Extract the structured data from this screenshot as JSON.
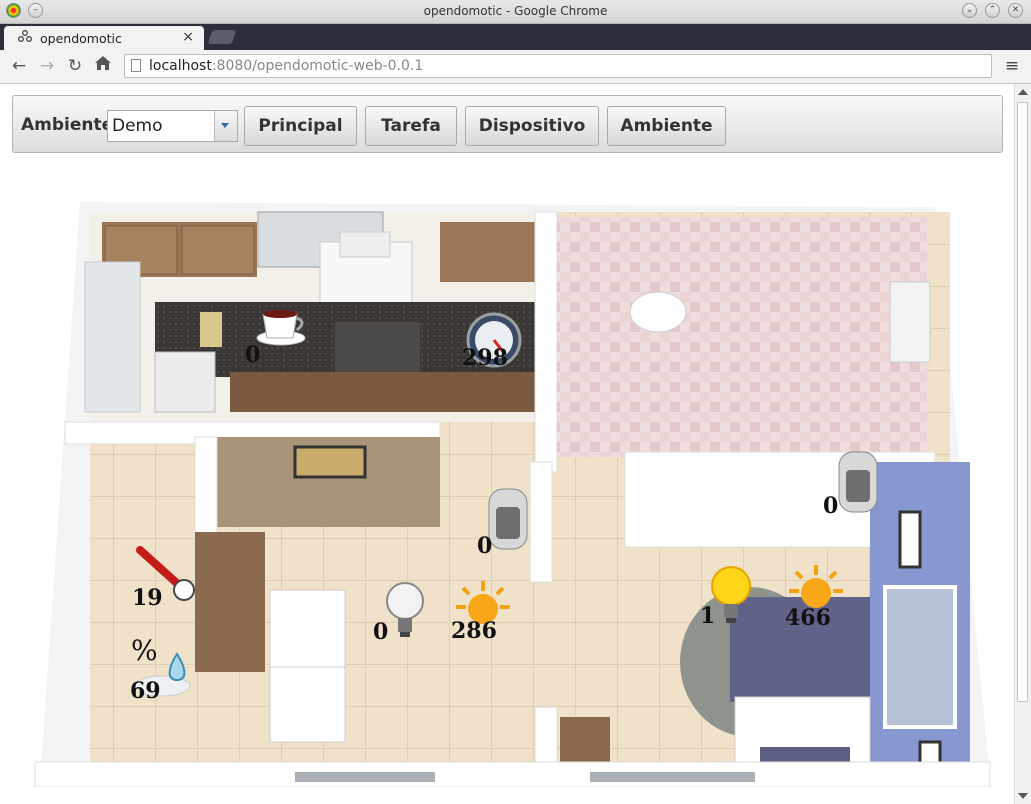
{
  "window": {
    "title": "opendomotic - Google Chrome"
  },
  "browser": {
    "tab_title": "opendomotic",
    "url_host": "localhost",
    "url_rest": ":8080/opendomotic-web-0.0.1"
  },
  "menubar": {
    "ambiente_label": "Ambiente",
    "ambiente_selected": "Demo",
    "buttons": [
      {
        "label": "Principal"
      },
      {
        "label": "Tarefa"
      },
      {
        "label": "Dispositivo"
      },
      {
        "label": "Ambiente"
      }
    ]
  },
  "devices": {
    "coffee_maker": {
      "value": "0",
      "icon": "coffee-cup-icon"
    },
    "gauge": {
      "value": "298",
      "icon": "gauge-icon"
    },
    "heater_living": {
      "value": "0",
      "icon": "heater-icon"
    },
    "heater_bedroom": {
      "value": "0",
      "icon": "heater-icon"
    },
    "lamp_living": {
      "value": "0",
      "icon": "light-bulb-off-icon"
    },
    "light_sensor_living": {
      "value": "286",
      "icon": "sun-icon"
    },
    "lamp_bedroom": {
      "value": "1",
      "icon": "light-bulb-on-icon"
    },
    "light_sensor_bedroom": {
      "value": "466",
      "icon": "sun-icon"
    },
    "temperature": {
      "value": "19",
      "icon": "thermometer-icon"
    },
    "humidity": {
      "value": "69",
      "symbol": "%",
      "icon": "humidity-drop-icon"
    }
  }
}
